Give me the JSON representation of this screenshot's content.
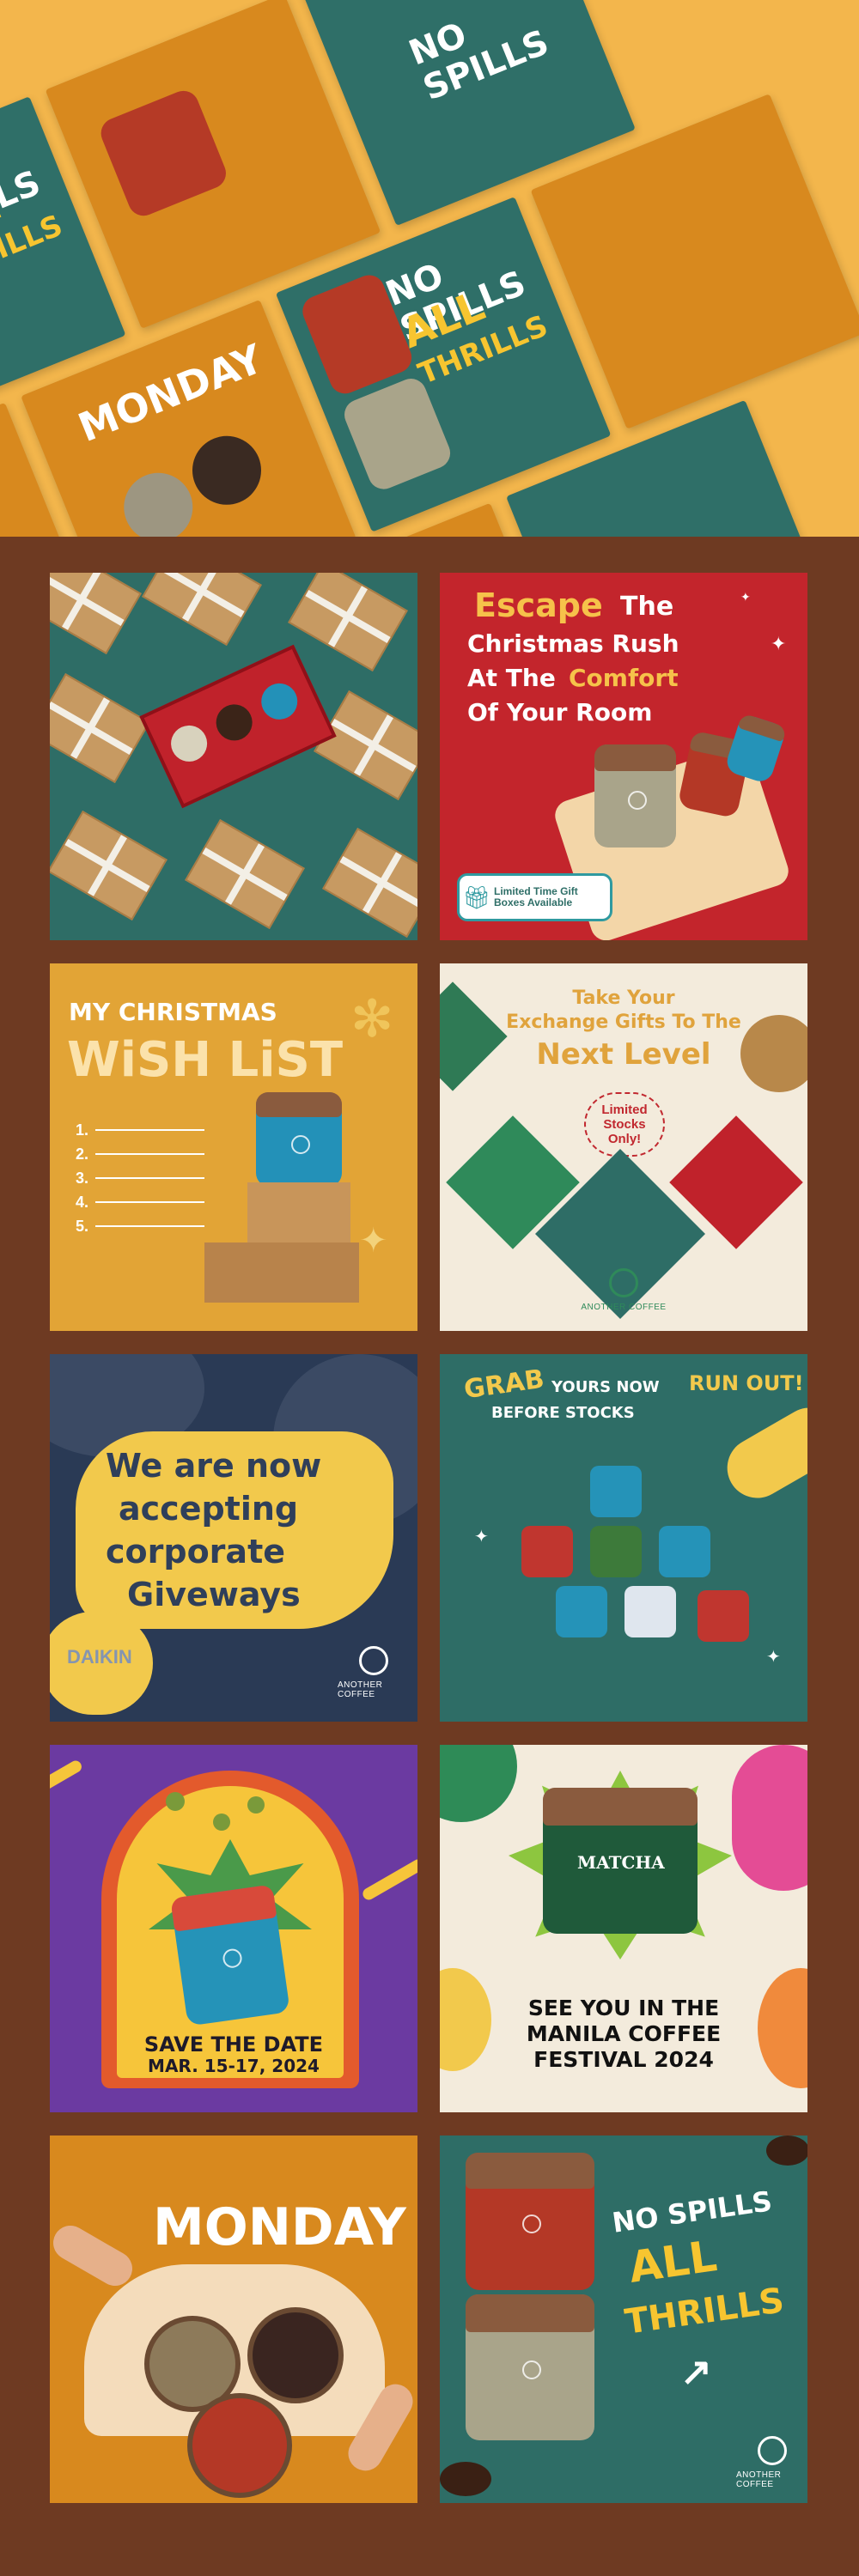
{
  "hero": {
    "phrases": [
      "NO SPILLS",
      "ALL",
      "THRILLS",
      "MONDAY"
    ],
    "brand": "ANOTHER COFFEE"
  },
  "tiles": {
    "gift_boxes": {
      "ribbon_text": "ANOTHER COFFEE"
    },
    "escape": {
      "line1_a": "Escape",
      "line1_b": "The",
      "line2": "Christmas Rush",
      "line3_a": "At The",
      "line3_b": "Comfort",
      "line4": "Of Your Room",
      "badge": "Limited Time Gift Boxes Available"
    },
    "wishlist": {
      "title_a": "MY CHRISTMAS",
      "title_b": "WiSH LiST",
      "items": [
        "1.",
        "2.",
        "3.",
        "4.",
        "5."
      ]
    },
    "exchange": {
      "line1": "Take Your",
      "line2": "Exchange Gifts To The",
      "line3": "Next Level",
      "badge": "Limited Stocks Only!",
      "brand": "ANOTHER COFFEE"
    },
    "corporate": {
      "lines": [
        "We are now",
        "accepting",
        "corporate",
        "Giveways"
      ],
      "brand": "ANOTHER COFFEE",
      "watermark": "DAIKIN"
    },
    "grab": {
      "line1_a": "GRAB",
      "line1_b": "YOURS NOW",
      "line1_c": "RUN OUT!",
      "line2": "BEFORE STOCKS"
    },
    "save_date": {
      "line1": "SAVE THE DATE",
      "line2": "MAR. 15-17, 2024"
    },
    "matcha": {
      "label": "MATCHA",
      "lines": [
        "SEE YOU IN THE",
        "MANILA COFFEE",
        "FESTIVAL 2024"
      ]
    },
    "monday": {
      "top": "MONDAY"
    },
    "no_spills": {
      "line1": "NO SPILLS",
      "line2": "ALL",
      "line3": "THRILLS",
      "brand": "ANOTHER COFFEE"
    }
  },
  "colors": {
    "background": "#6e3a22",
    "teal": "#2f6f68",
    "orange": "#d8891e",
    "red": "#c1282f",
    "yellow": "#f7c530",
    "purple": "#6b3aa1"
  }
}
